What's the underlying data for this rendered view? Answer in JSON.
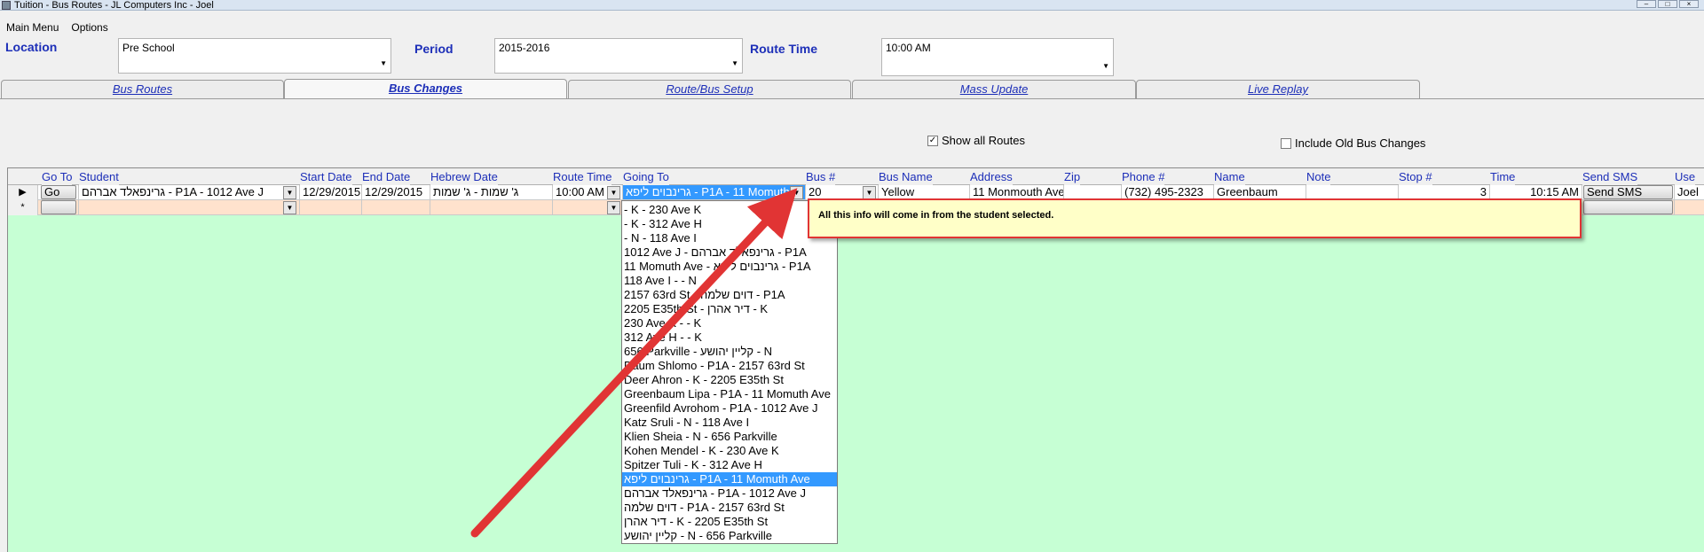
{
  "window": {
    "title": "Tuition - Bus Routes - JL Computers Inc - Joel"
  },
  "menu": [
    "Main Menu",
    "Options"
  ],
  "filters": {
    "location": {
      "label": "Location",
      "value": "Pre School"
    },
    "period": {
      "label": "Period",
      "value": "2015-2016"
    },
    "route_time": {
      "label": "Route Time",
      "value": "10:00 AM"
    }
  },
  "tabs": [
    "Bus Routes",
    "Bus Changes",
    "Route/Bus Setup",
    "Mass Update",
    "Live Replay"
  ],
  "active_tab": "Bus Changes",
  "checkboxes": {
    "show_all_routes": {
      "label": "Show all Routes",
      "checked": true
    },
    "include_old": {
      "label": "Include Old Bus Changes",
      "checked": false
    }
  },
  "grid": {
    "columns": [
      "Go To",
      "Student",
      "Start Date",
      "End Date",
      "Hebrew Date",
      "Route Time",
      "Going To",
      "Bus #",
      "Bus Name",
      "Address",
      "Zip",
      "Phone #",
      "Name",
      "Note",
      "Stop #",
      "Time",
      "Send SMS",
      "Use"
    ],
    "row": {
      "go_to": "Go",
      "student": "גרינפאלד אברהם - P1A - 1012 Ave J",
      "start_date": "12/29/2015",
      "end_date": "12/29/2015",
      "hebrew_date": "ג' שמות - ג' שמות",
      "route_time": "10:00 AM",
      "going_to": "גרינבוים ליפא - P1A - 11 Momuth",
      "bus_num": "20",
      "bus_name": "Yellow",
      "address": "11 Monmouth Ave",
      "zip": "",
      "phone": "(732) 495-2323",
      "name": "Greenbaum",
      "note": "",
      "stop": "3",
      "time": "10:15 AM",
      "send_sms": "Send SMS",
      "use": "Joel"
    },
    "new_row_marker": "*",
    "current_row_marker": "▶"
  },
  "dropdown_items": [
    "- K - 230 Ave K",
    "- K - 312 Ave H",
    "- N - 118 Ave I",
    "1012 Ave J - גרינפאלד אברהם - P1A",
    "11 Momuth Ave - גרינבוים ליפא - P1A",
    "118 Ave I -    - N",
    "2157 63rd St - דוים שלמה - P1A",
    "2205 E35th St - דיר אהרן - K",
    "230 Ave K -    - K",
    "312 Ave H -    - K",
    "656 Parkville - קליין יהושע - N",
    "Daum Shlomo - P1A - 2157 63rd St",
    "Deer Ahron - K - 2205 E35th St",
    "Greenbaum Lipa - P1A - 11 Momuth Ave",
    "Greenfild Avrohom - P1A - 1012 Ave J",
    "Katz Sruli - N - 118 Ave I",
    "Klien Sheia - N - 656 Parkville",
    "Kohen Mendel - K - 230 Ave K",
    "Spitzer Tuli - K - 312 Ave H",
    "גרינבוים ליפא - P1A - 11 Momuth Ave",
    "גרינפאלד אברהם - P1A - 1012 Ave J",
    "דוים שלמה - P1A - 2157 63rd St",
    "דיר אהרן - K - 2205 E35th St",
    "קליין יהושע - N - 656 Parkville"
  ],
  "dropdown_selected": 19,
  "annotation": "All this info will come in from the student selected.",
  "colors": {
    "accent_label": "#1d2fb8",
    "grid_bg": "#c6ffd4",
    "highlight": "#3399ff",
    "arrow": "#e13434",
    "tooltip_bg": "#ffffc8"
  }
}
